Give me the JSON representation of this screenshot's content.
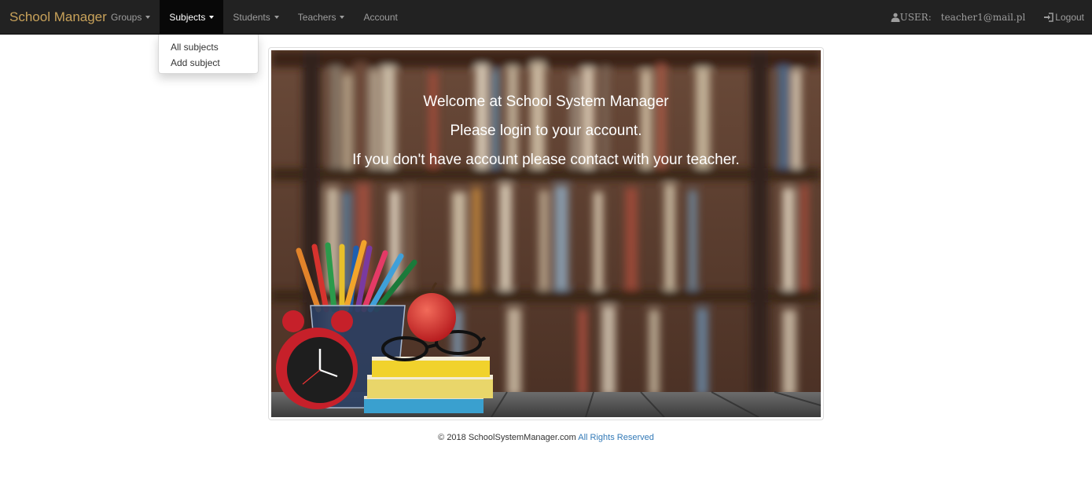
{
  "navbar": {
    "brand": "School Manager",
    "items": [
      {
        "label": "Groups",
        "dropdown": true,
        "active": false
      },
      {
        "label": "Subjects",
        "dropdown": true,
        "active": true
      },
      {
        "label": "Students",
        "dropdown": true,
        "active": false
      },
      {
        "label": "Teachers",
        "dropdown": true,
        "active": false
      },
      {
        "label": "Account",
        "dropdown": false,
        "active": false
      }
    ],
    "user_label": "USER:",
    "user_email": "teacher1@mail.pl",
    "logout_label": "Logout",
    "user_icon": "user-icon",
    "logout_icon": "log-out-icon"
  },
  "subjects_menu": {
    "items": [
      "All subjects",
      "Add subject"
    ]
  },
  "hero": {
    "line1": "Welcome at School System Manager",
    "line2": "Please login to your account.",
    "line3": "If you don't have account please contact with your teacher."
  },
  "footer": {
    "copyright": "© 2018 SchoolSystemManager.com",
    "rights_link": "All Rights Reserved"
  },
  "colors": {
    "navbar_bg": "#222222",
    "brand": "#c8a25a",
    "link": "#337ab7"
  }
}
